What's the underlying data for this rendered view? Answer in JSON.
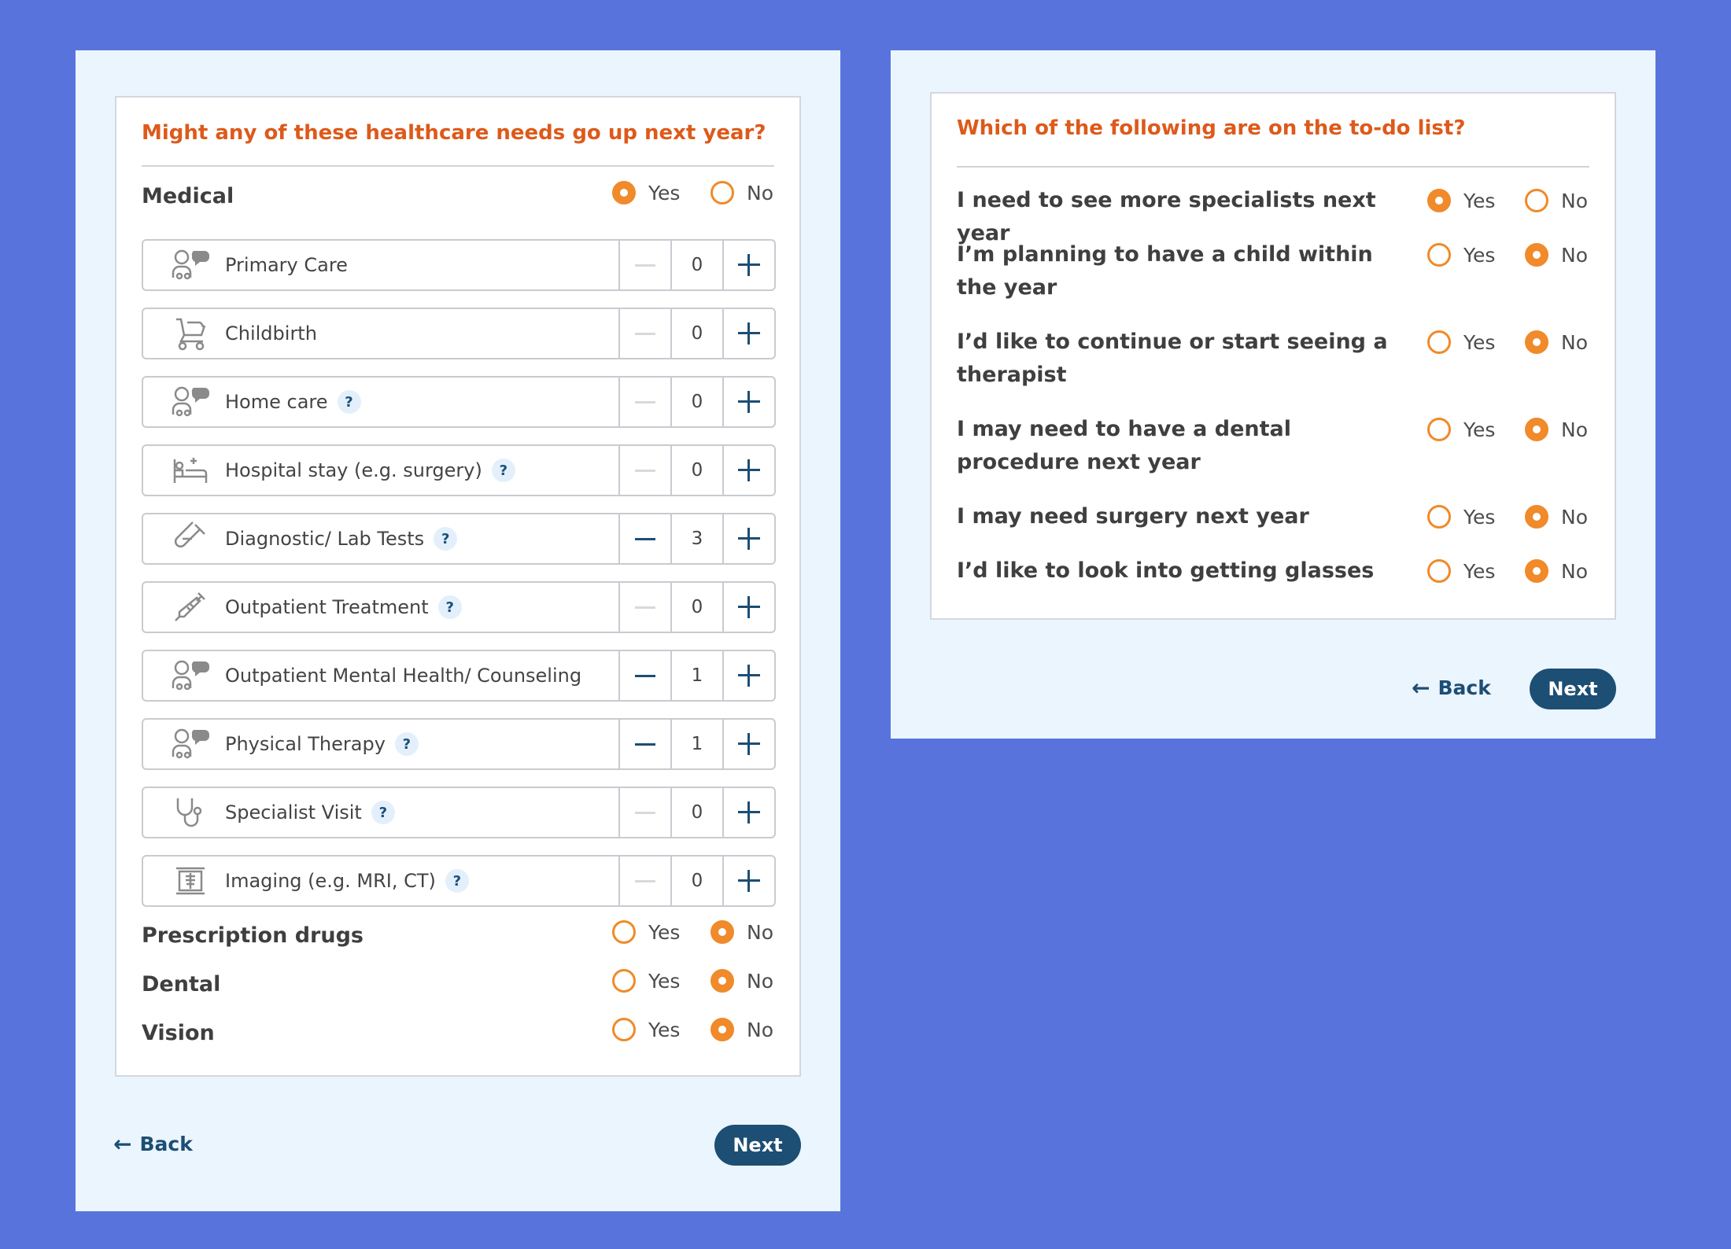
{
  "left": {
    "question": "Might any of these healthcare needs go up next year?",
    "medical": {
      "label": "Medical",
      "yes": "Yes",
      "no": "No",
      "selected": "yes"
    },
    "services": [
      {
        "label": "Primary Care",
        "value": "0",
        "help": false,
        "icon": "people-chat-icon"
      },
      {
        "label": "Childbirth",
        "value": "0",
        "help": false,
        "icon": "stroller-icon"
      },
      {
        "label": "Home care",
        "value": "0",
        "help": true,
        "icon": "people-chat-icon"
      },
      {
        "label": "Hospital stay (e.g. surgery)",
        "value": "0",
        "help": true,
        "icon": "hospital-bed-icon"
      },
      {
        "label": "Diagnostic/ Lab Tests",
        "value": "3",
        "help": true,
        "icon": "test-tube-icon"
      },
      {
        "label": "Outpatient Treatment",
        "value": "0",
        "help": true,
        "icon": "syringe-icon"
      },
      {
        "label": "Outpatient Mental Health/ Counseling",
        "value": "1",
        "help": false,
        "icon": "people-chat-icon"
      },
      {
        "label": "Physical Therapy",
        "value": "1",
        "help": true,
        "icon": "people-chat-icon"
      },
      {
        "label": "Specialist Visit",
        "value": "0",
        "help": true,
        "icon": "stethoscope-icon"
      },
      {
        "label": "Imaging (e.g. MRI, CT)",
        "value": "0",
        "help": true,
        "icon": "xray-icon"
      }
    ],
    "help_mark": "?",
    "categories": [
      {
        "label": "Prescription drugs",
        "yes": "Yes",
        "no": "No",
        "selected": "no"
      },
      {
        "label": "Dental",
        "yes": "Yes",
        "no": "No",
        "selected": "no"
      },
      {
        "label": "Vision",
        "yes": "Yes",
        "no": "No",
        "selected": "no"
      }
    ],
    "back": "Back",
    "next": "Next"
  },
  "right": {
    "question": "Which of the following are on the to-do list?",
    "items": [
      {
        "label": "I need to see more specialists next year",
        "yes": "Yes",
        "no": "No",
        "selected": "yes"
      },
      {
        "label": "I’m planning to have a child within the year",
        "yes": "Yes",
        "no": "No",
        "selected": "no"
      },
      {
        "label": "I’d like to continue or start seeing a therapist",
        "yes": "Yes",
        "no": "No",
        "selected": "no"
      },
      {
        "label": "I may need to have a dental procedure next year",
        "yes": "Yes",
        "no": "No",
        "selected": "no"
      },
      {
        "label": "I may need surgery next year",
        "yes": "Yes",
        "no": "No",
        "selected": "no"
      },
      {
        "label": "I’d like to look into getting glasses",
        "yes": "Yes",
        "no": "No",
        "selected": "no"
      }
    ],
    "back": "Back",
    "next": "Next"
  },
  "colors": {
    "background": "#5874dc",
    "panel": "#ebf5fe",
    "accent": "#f08a2a",
    "title": "#dd5a1b",
    "primary": "#1d4e74"
  }
}
